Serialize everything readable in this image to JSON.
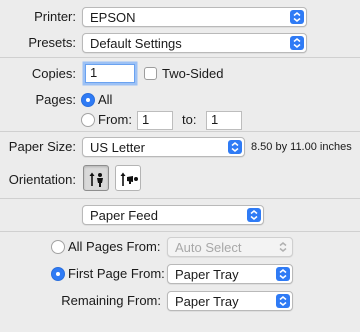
{
  "printer": {
    "label": "Printer:",
    "value": "EPSON"
  },
  "presets": {
    "label": "Presets:",
    "value": "Default Settings"
  },
  "copies": {
    "label": "Copies:",
    "value": "1",
    "two_sided_label": "Two-Sided"
  },
  "pages": {
    "label": "Pages:",
    "all_label": "All",
    "from_label": "From:",
    "from_value": "1",
    "to_label": "to:",
    "to_value": "1"
  },
  "paper_size": {
    "label": "Paper Size:",
    "value": "US Letter",
    "dimensions": "8.50 by 11.00 inches"
  },
  "orientation": {
    "label": "Orientation:",
    "portrait_icon": "portrait-orientation-icon",
    "landscape_icon": "landscape-orientation-icon",
    "selected": "portrait"
  },
  "section": {
    "value": "Paper Feed"
  },
  "paper_feed": {
    "all_pages_label": "All Pages From:",
    "all_pages_value": "Auto Select",
    "first_page_label": "First Page From:",
    "first_page_value": "Paper Tray",
    "remaining_label": "Remaining From:",
    "remaining_value": "Paper Tray",
    "selected": "first_page"
  },
  "colors": {
    "accent": "#2f7bf5",
    "background": "#ececec"
  }
}
